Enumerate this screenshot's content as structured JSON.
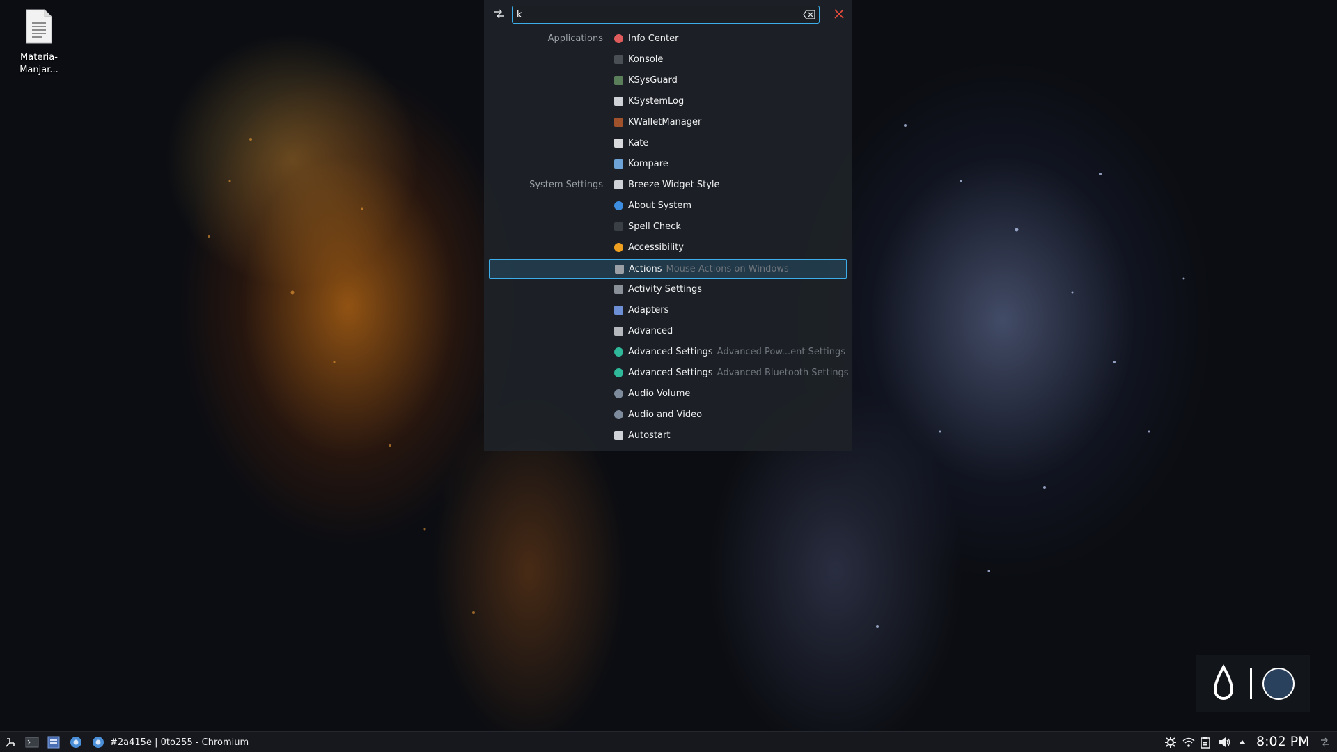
{
  "desktop": {
    "file_icon": {
      "line1": "Materia-",
      "line2": "Manjar..."
    }
  },
  "krunner": {
    "search": {
      "value": "k",
      "placeholder": ""
    },
    "groups": [
      {
        "label": "Applications",
        "items": [
          {
            "title": "Info Center",
            "subtitle": "",
            "icon": "info-center-icon",
            "color": "#e05c5c"
          },
          {
            "title": "Konsole",
            "subtitle": "",
            "icon": "terminal-icon",
            "color": "#4a4f55"
          },
          {
            "title": "KSysGuard",
            "subtitle": "",
            "icon": "system-monitor-icon",
            "color": "#5a7d5a"
          },
          {
            "title": "KSystemLog",
            "subtitle": "",
            "icon": "log-icon",
            "color": "#cfd2d6"
          },
          {
            "title": "KWalletManager",
            "subtitle": "",
            "icon": "wallet-icon",
            "color": "#a0522d"
          },
          {
            "title": "Kate",
            "subtitle": "",
            "icon": "text-editor-icon",
            "color": "#d8dadd"
          },
          {
            "title": "Kompare",
            "subtitle": "",
            "icon": "compare-icon",
            "color": "#6ea3d8"
          }
        ]
      },
      {
        "label": "System Settings",
        "items": [
          {
            "title": "Breeze Widget Style",
            "subtitle": "",
            "icon": "widget-style-icon",
            "color": "#cfd2d6"
          },
          {
            "title": "About System",
            "subtitle": "",
            "icon": "about-icon",
            "color": "#3d8ee0"
          },
          {
            "title": "Spell Check",
            "subtitle": "",
            "icon": "spell-check-icon",
            "color": "#3a3f45"
          },
          {
            "title": "Accessibility",
            "subtitle": "",
            "icon": "accessibility-icon",
            "color": "#f0a020"
          },
          {
            "title": "Actions",
            "subtitle": "Mouse Actions on Windows",
            "icon": "actions-icon",
            "color": "#9aa0a6",
            "selected": true
          },
          {
            "title": "Activity Settings",
            "subtitle": "",
            "icon": "activity-icon",
            "color": "#8a9097"
          },
          {
            "title": "Adapters",
            "subtitle": "",
            "icon": "bluetooth-icon",
            "color": "#6c8fd6"
          },
          {
            "title": "Advanced",
            "subtitle": "",
            "icon": "advanced-icon",
            "color": "#b5b9be"
          },
          {
            "title": "Advanced Settings",
            "subtitle": "Advanced Pow...ent Settings",
            "icon": "gear-icon",
            "color": "#2fb89a"
          },
          {
            "title": "Advanced Settings",
            "subtitle": "Advanced Bluetooth Settings",
            "icon": "gear-icon",
            "color": "#2fb89a"
          },
          {
            "title": "Audio Volume",
            "subtitle": "",
            "icon": "audio-icon",
            "color": "#7d8b9c"
          },
          {
            "title": "Audio and Video",
            "subtitle": "",
            "icon": "audio-video-icon",
            "color": "#7d8b9c"
          },
          {
            "title": "Autostart",
            "subtitle": "",
            "icon": "autostart-icon",
            "color": "#cfd2d6"
          }
        ]
      }
    ]
  },
  "taskbar": {
    "task_label": "#2a415e | 0to255 - Chromium",
    "clock": "8:02 PM"
  },
  "colors": {
    "accent": "#3daee9",
    "close_red": "#e74c3c",
    "logo_circle": "#2a415e"
  }
}
